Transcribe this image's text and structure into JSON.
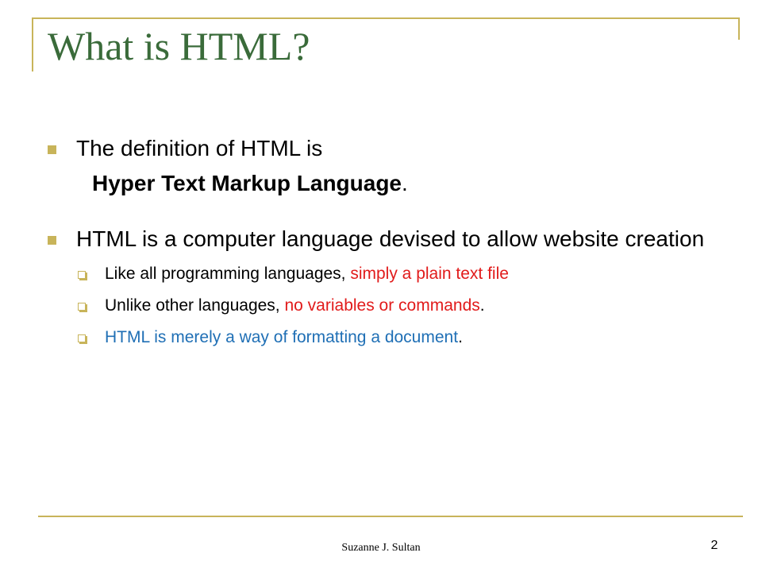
{
  "slide": {
    "title": "What is HTML?",
    "bullets": [
      {
        "text": "The definition of HTML is",
        "subline_bold": "Hyper Text Markup Language",
        "subline_end": "."
      },
      {
        "text": "HTML is a computer language devised to allow website creation",
        "sub_bullets": [
          {
            "plain": "Like all programming languages, ",
            "red": "simply a plain text file",
            "end": ""
          },
          {
            "plain": "Unlike other languages, ",
            "red": "no variables or commands",
            "end": "."
          },
          {
            "blue": "HTML is merely a way of formatting a document",
            "end": "."
          }
        ]
      }
    ],
    "footer": {
      "author": "Suzanne J. Sultan",
      "page_number": "2"
    },
    "colors": {
      "title": "#3a6b3a",
      "accent": "#c8b45a",
      "emphasis_red": "#e11b1b",
      "emphasis_blue": "#1f6fb5"
    }
  }
}
